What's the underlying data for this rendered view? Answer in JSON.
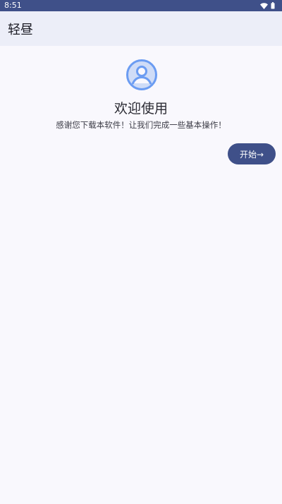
{
  "status_bar": {
    "time": "8:51",
    "icons": [
      "wifi-icon",
      "battery-icon"
    ]
  },
  "app_bar": {
    "title": "轻昼"
  },
  "welcome": {
    "icon": "account-circle-icon",
    "title": "欢迎使用",
    "subtitle": "感谢您下载本软件！让我们完成一些基本操作！",
    "start_button_label": "开始→"
  },
  "colors": {
    "primary": "#3f5089",
    "app_bar_background": "#eceef8",
    "page_background": "#f9f8fd",
    "avatar_accent": "#6b9cf2"
  }
}
